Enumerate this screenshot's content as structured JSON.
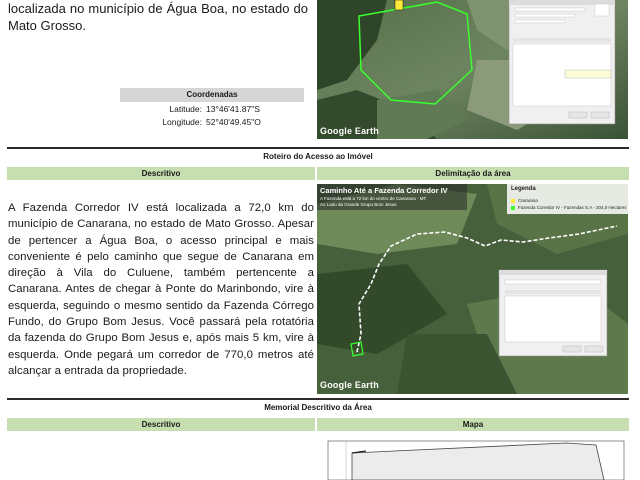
{
  "section1": {
    "text": "localizada no município de Água Boa, no estado do Mato Grosso.",
    "coordinates_title": "Coordenadas",
    "latitude_label": "Latitude:",
    "latitude_value": "13°46'41.87\"S",
    "longitude_label": "Longitude:",
    "longitude_value": "52°40'49.45\"O",
    "map_brand": "Google Earth"
  },
  "section2": {
    "title": "Roteiro do Acesso ao Imóvel",
    "col_left": "Descritivo",
    "col_right": "Delimitação da área",
    "paragraph": "A Fazenda Corredor IV está localizada a 72,0 km do município de Canarana, no estado de Mato Grosso. Apesar de pertencer a Água Boa, o acesso principal e mais conveniente é pelo caminho que segue de Canarana em direção à Vila do Culuene, também pertencente a Canarana. Antes de chegar à Ponte do Marinbondo, vire à esquerda, seguindo o mesmo sentido da Fazenda Córrego Fundo, do Grupo Bom Jesus. Você passará pela rotatória da fazenda do Grupo Bom Jesus e, após mais 5 km, vire à esquerda. Onde pegará um corredor de 770,0 metros até alcançar a entrada da propriedade.",
    "map_title": "Caminho Até a Fazenda Corredor IV",
    "map_subtitle_1": "A Fazenda está a 72 km do centro de Canarana - MT",
    "map_subtitle_2": "Ao Lado da Grande Grupo Bom Jesus",
    "legend_title": "Legenda",
    "legend_items": [
      "Canarana",
      "Fazenda Corredor IV - Fazendas S.A - 204,0 Hectares"
    ],
    "map_brand": "Google Earth"
  },
  "section3": {
    "title": "Memorial Descritivo da Área",
    "col_left": "Descritivo",
    "col_right": "Mapa"
  },
  "colors": {
    "header_green": "#c6deb0",
    "boundary_green": "#3bff2e",
    "route_white": "#ffffff"
  }
}
